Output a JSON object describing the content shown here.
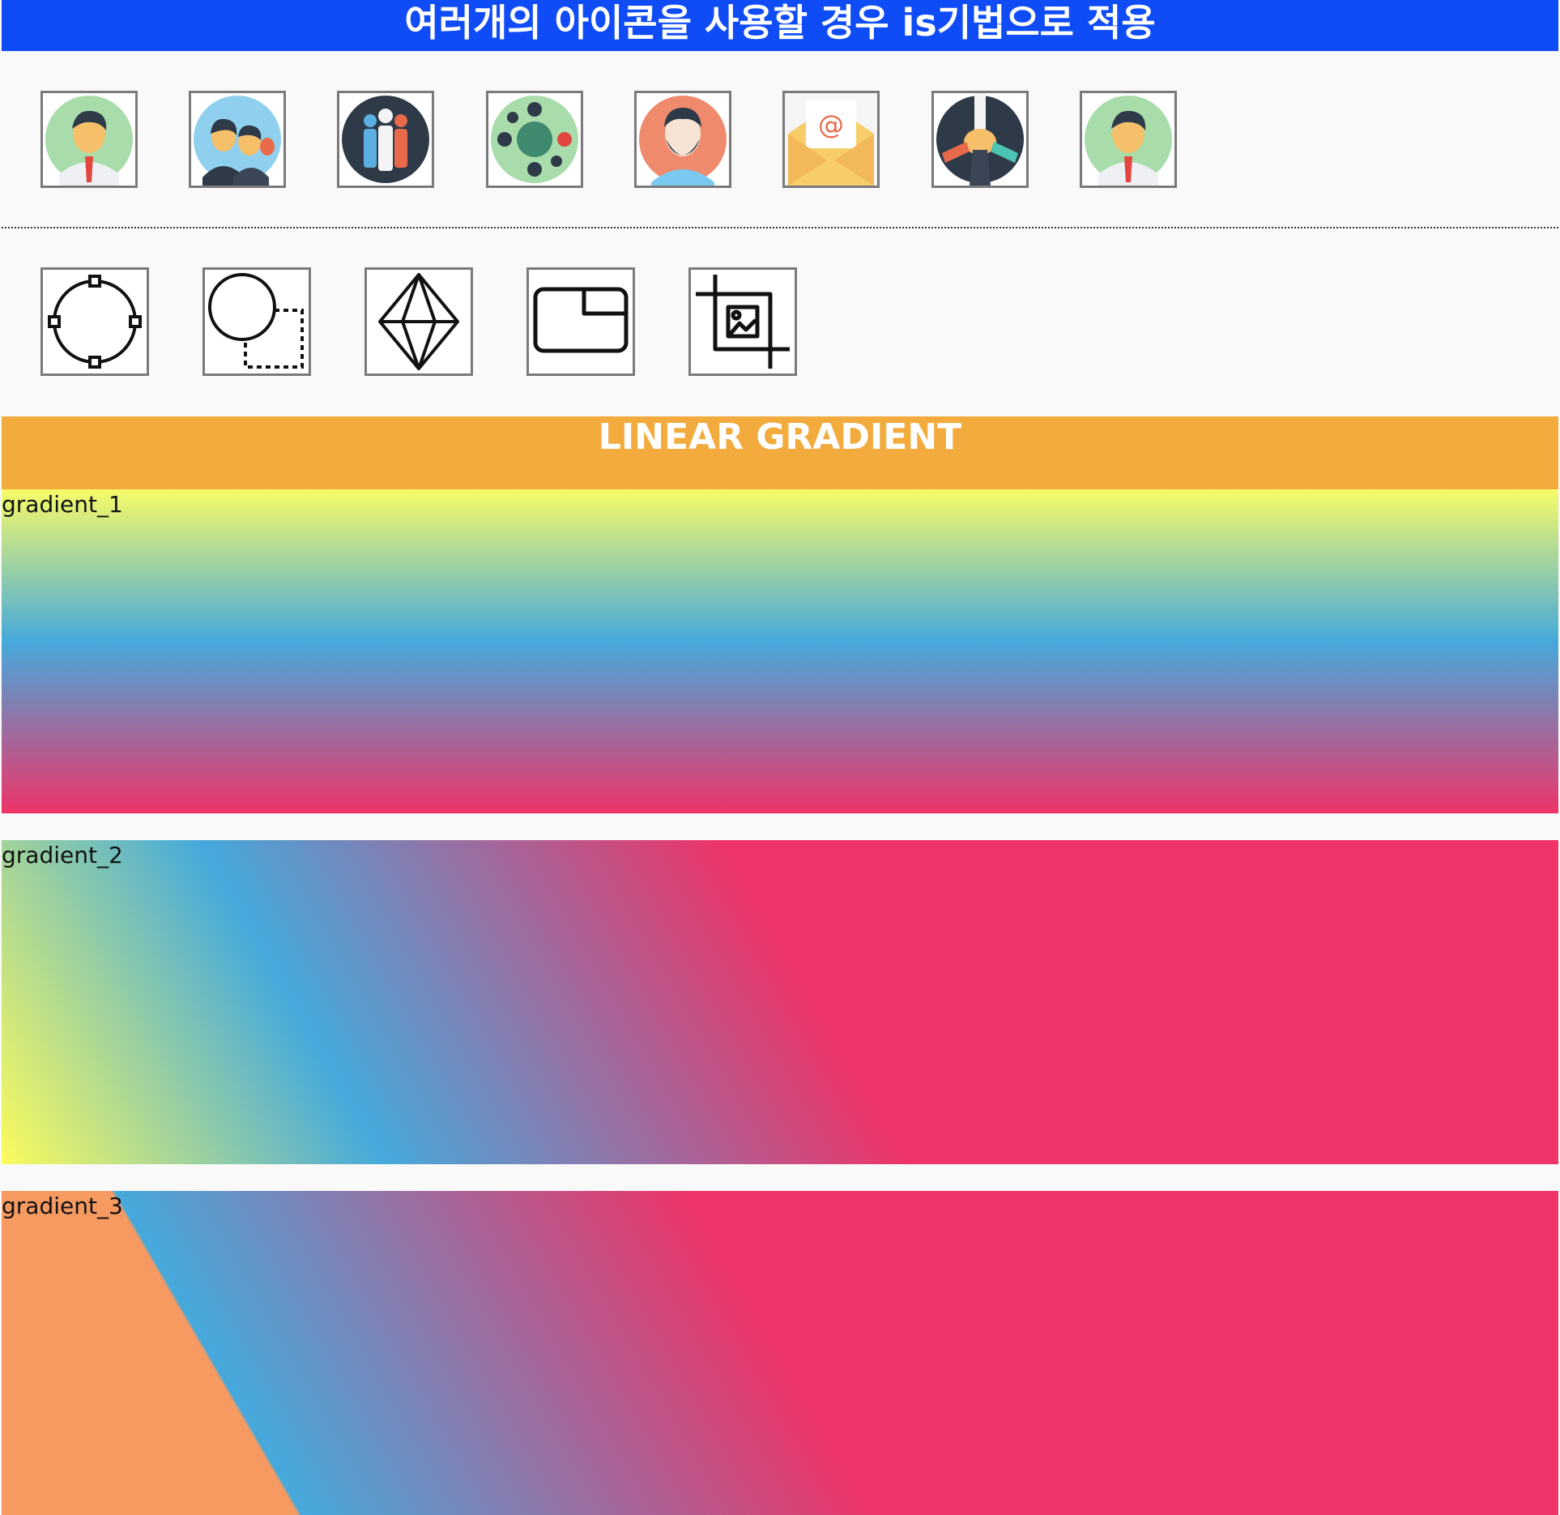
{
  "header": {
    "title": "여러개의 아이콘을 사용할 경우 is기법으로 적용"
  },
  "avatar_icons": [
    "businessman-icon",
    "team-members-icon",
    "group-people-icon",
    "meeting-table-icon",
    "bearded-man-icon",
    "email-envelope-icon",
    "hands-together-icon",
    "businessman-icon"
  ],
  "tool_icons": [
    "circle-select-icon",
    "circle-resize-icon",
    "crystal-icon",
    "window-tab-icon",
    "crop-image-icon"
  ],
  "section": {
    "title": "LINEAR GRADIENT"
  },
  "gradients": [
    {
      "label": "gradient_1"
    },
    {
      "label": "gradient_2"
    },
    {
      "label": "gradient_3"
    }
  ],
  "colors": {
    "header_bg": "#0f4cf5",
    "section_bg": "#f2ab3c",
    "gradient_yellow": "#f7fb68",
    "gradient_blue": "#45a9dc",
    "gradient_pink": "#ee3468",
    "gradient_orange": "#f69a61"
  }
}
